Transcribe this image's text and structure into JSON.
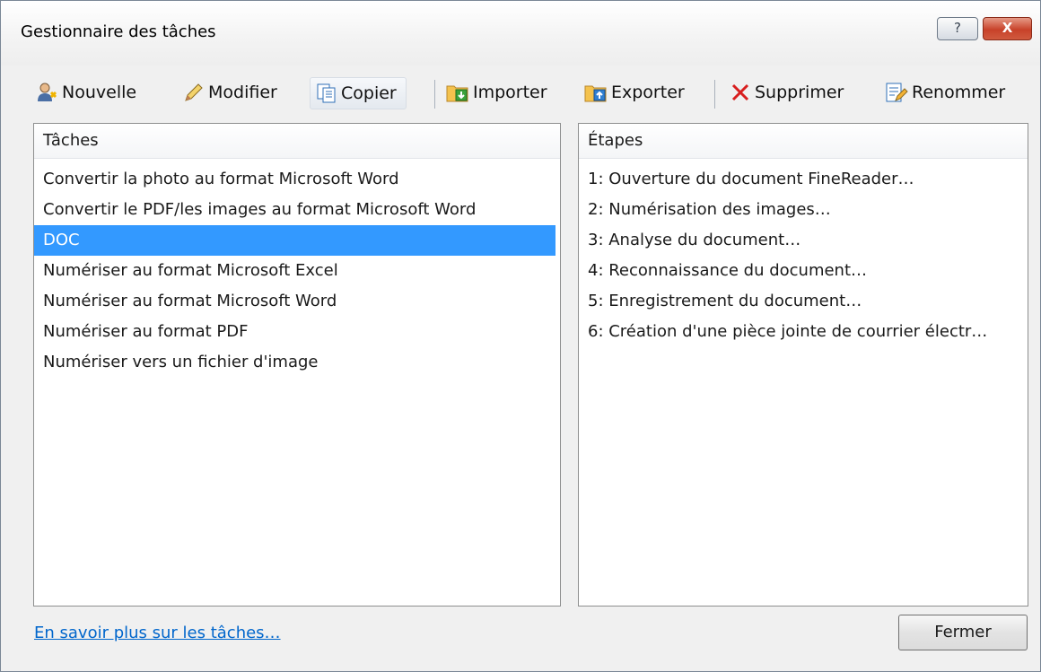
{
  "window": {
    "title": "Gestionnaire des tâches",
    "help_label": "?",
    "close_label": "X"
  },
  "toolbar": {
    "new_label": "Nouvelle",
    "edit_label": "Modifier",
    "copy_label": "Copier",
    "import_label": "Importer",
    "export_label": "Exporter",
    "delete_label": "Supprimer",
    "rename_label": "Renommer"
  },
  "tasks": {
    "header": "Tâches",
    "items": [
      "Convertir la photo au format Microsoft Word",
      "Convertir le PDF/les images au format Microsoft Word",
      "DOC",
      "Numériser au format Microsoft Excel",
      "Numériser au format Microsoft Word",
      "Numériser au format PDF",
      "Numériser vers un fichier d'image"
    ],
    "selected_index": 2
  },
  "steps": {
    "header": "Étapes",
    "items": [
      "1: Ouverture du document FineReader…",
      "2: Numérisation des images…",
      "3: Analyse du document…",
      "4: Reconnaissance du document…",
      "5: Enregistrement du document…",
      "6: Création d'une pièce jointe de courrier électr…"
    ]
  },
  "footer": {
    "learn_more_link": "En savoir plus sur les tâches…",
    "close_button": "Fermer"
  }
}
